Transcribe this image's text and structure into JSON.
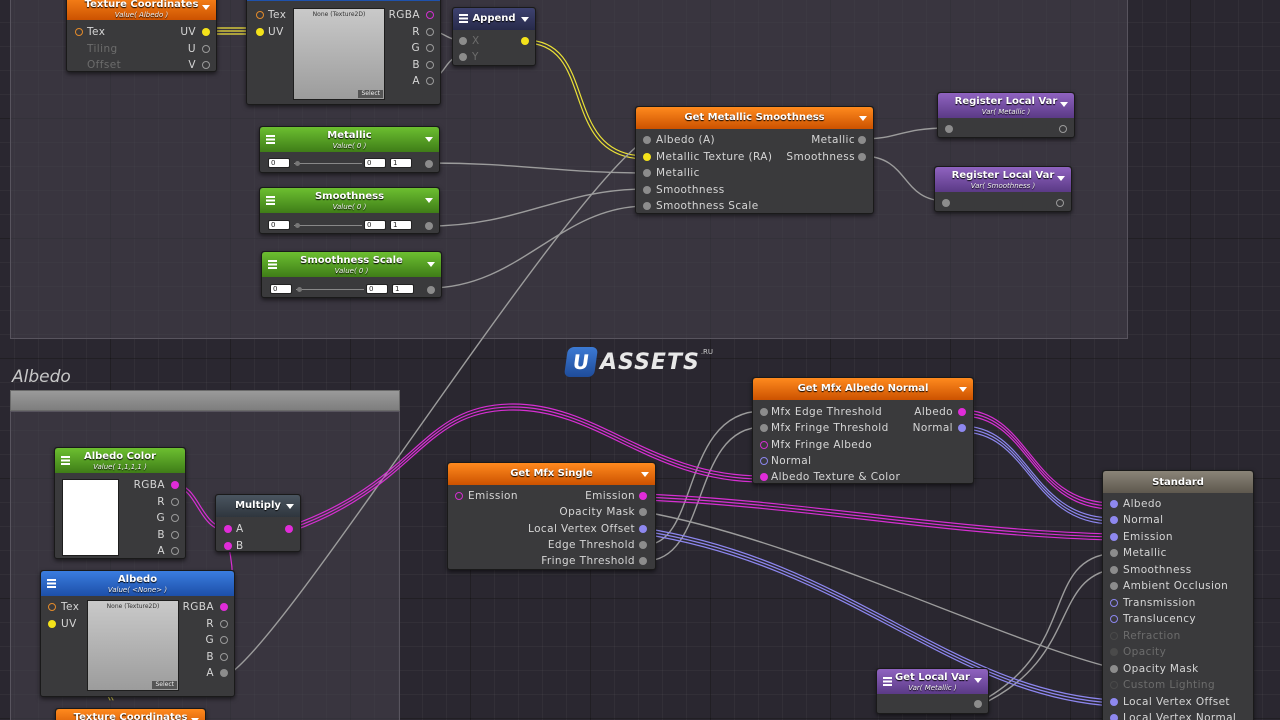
{
  "groups": {
    "albedo": {
      "title": "Albedo"
    }
  },
  "logo": {
    "mark": "U",
    "text": "ASSETS",
    "suffix": ".RU"
  },
  "nodes": {
    "tex_coords_top": {
      "title": "Texture Coordinates",
      "subtitle": "Value( Albedo )",
      "inputs": [
        "Tex",
        "Tiling",
        "Offset"
      ],
      "outputs": [
        "UV",
        "U",
        "V"
      ]
    },
    "texture_top": {
      "inputs": [
        "Tex",
        "UV"
      ],
      "outputs": [
        "RGBA",
        "R",
        "G",
        "B",
        "A"
      ],
      "preview_label": "None (Texture2D)",
      "select": "Select"
    },
    "append": {
      "title": "Append",
      "inputs": [
        "X",
        "Y"
      ]
    },
    "metallic": {
      "title": "Metallic",
      "subtitle": "Value( 0 )",
      "value": "0",
      "min": "0",
      "max": "1"
    },
    "smoothness": {
      "title": "Smoothness",
      "subtitle": "Value( 0 )",
      "value": "0",
      "min": "0",
      "max": "1"
    },
    "smoothness_scale": {
      "title": "Smoothness Scale",
      "subtitle": "Value( 0 )",
      "value": "0",
      "min": "0",
      "max": "1"
    },
    "get_metallic_smoothness": {
      "title": "Get Metallic Smoothness",
      "inputs": [
        "Albedo (A)",
        "Metallic Texture (RA)",
        "Metallic",
        "Smoothness",
        "Smoothness Scale"
      ],
      "outputs": [
        "Metallic",
        "Smoothness"
      ]
    },
    "register_metallic": {
      "title": "Register Local Var",
      "subtitle": "Var( Metallic )"
    },
    "register_smoothness": {
      "title": "Register Local Var",
      "subtitle": "Var( Smoothness )"
    },
    "albedo_color": {
      "title": "Albedo Color",
      "subtitle": "Value( 1,1,1,1 )",
      "outputs": [
        "RGBA",
        "R",
        "G",
        "B",
        "A"
      ]
    },
    "multiply": {
      "title": "Multiply",
      "inputs": [
        "A",
        "B"
      ]
    },
    "albedo_tex": {
      "title": "Albedo",
      "subtitle": "Value( <None> )",
      "inputs": [
        "Tex",
        "UV"
      ],
      "outputs": [
        "RGBA",
        "R",
        "G",
        "B",
        "A"
      ],
      "preview_label": "None (Texture2D)",
      "select": "Select"
    },
    "tex_coords_bottom": {
      "title": "Texture Coordinates"
    },
    "get_mfx_single": {
      "title": "Get Mfx Single",
      "inputs": [
        "Emission"
      ],
      "outputs": [
        "Emission",
        "Opacity Mask",
        "Local Vertex Offset",
        "Edge Threshold",
        "Fringe Threshold"
      ]
    },
    "get_mfx_albedo_normal": {
      "title": "Get Mfx Albedo Normal",
      "inputs": [
        "Mfx Edge Threshold",
        "Mfx Fringe Threshold",
        "Mfx Fringe Albedo",
        "Normal",
        "Albedo Texture & Color"
      ],
      "outputs": [
        "Albedo",
        "Normal"
      ]
    },
    "standard": {
      "title": "Standard",
      "inputs": [
        "Albedo",
        "Normal",
        "Emission",
        "Metallic",
        "Smoothness",
        "Ambient Occlusion",
        "Transmission",
        "Translucency",
        "Refraction",
        "Opacity",
        "Opacity Mask",
        "Custom Lighting",
        "Local Vertex Offset",
        "Local Vertex Normal"
      ]
    },
    "get_local_var": {
      "title": "Get Local Var",
      "subtitle": "Var( Metallic )"
    }
  }
}
